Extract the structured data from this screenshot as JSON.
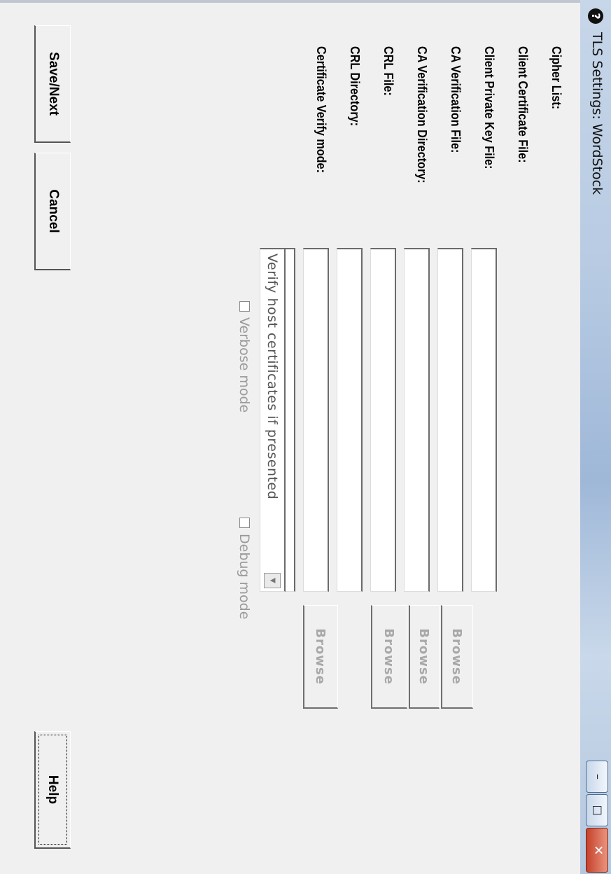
{
  "window": {
    "title": "TLS Settings: WordStock",
    "controls": {
      "minimize": "–",
      "maximize": "□",
      "close": "✕"
    },
    "icon": "help-icon"
  },
  "form": {
    "fields": [
      {
        "label": "Cipher List:",
        "value": "",
        "browse": null
      },
      {
        "label": "Client Certificate File:",
        "value": "",
        "browse": "Browse"
      },
      {
        "label": "Client Private Key File:",
        "value": "",
        "browse": "Browse"
      },
      {
        "label": "CA Verification File:",
        "value": "",
        "browse": "Browse"
      },
      {
        "label": "CA Verification Directory:",
        "value": "",
        "browse": null
      },
      {
        "label": "CRL File:",
        "value": "",
        "browse": "Browse"
      },
      {
        "label": "CRL Directory:",
        "value": "",
        "browse": null
      }
    ],
    "verify_mode": {
      "label": "Certificate Verify mode:",
      "selected": "Verify host certificates if presented"
    },
    "checkboxes": {
      "verbose": {
        "label": "Verbose mode",
        "checked": false
      },
      "debug": {
        "label": "Debug mode",
        "checked": false
      }
    }
  },
  "buttons": {
    "save": "Save/Next",
    "cancel": "Cancel",
    "help": "Help"
  }
}
